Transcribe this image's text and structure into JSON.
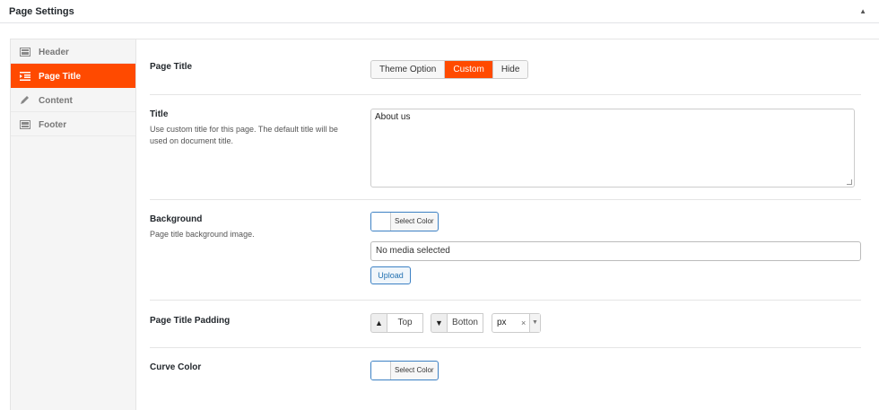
{
  "header": {
    "title": "Page Settings",
    "toggle_icon": "▲"
  },
  "sidebar": {
    "items": [
      {
        "label": "Header",
        "icon": "layout-icon"
      },
      {
        "label": "Page Title",
        "icon": "indent-icon"
      },
      {
        "label": "Content",
        "icon": "pencil-icon"
      },
      {
        "label": "Footer",
        "icon": "layout-icon"
      }
    ],
    "active_index": 1
  },
  "page_title": {
    "label": "Page Title",
    "options": [
      "Theme Option",
      "Custom",
      "Hide"
    ],
    "selected": "Custom"
  },
  "title_field": {
    "label": "Title",
    "description": "Use custom title for this page. The default title will be used on document title.",
    "value": "About us"
  },
  "background": {
    "label": "Background",
    "description": "Page title background image.",
    "color_button": "Select Color",
    "media_value": "No media selected",
    "upload_label": "Upload"
  },
  "padding": {
    "label": "Page Title Padding",
    "top_placeholder": "Top",
    "bottom_placeholder": "Botton",
    "unit": "px",
    "unit_clear": "×"
  },
  "curve": {
    "label": "Curve Color",
    "color_button": "Select Color"
  },
  "colors": {
    "accent": "#ff4a00",
    "button_border": "#3d81c4"
  }
}
